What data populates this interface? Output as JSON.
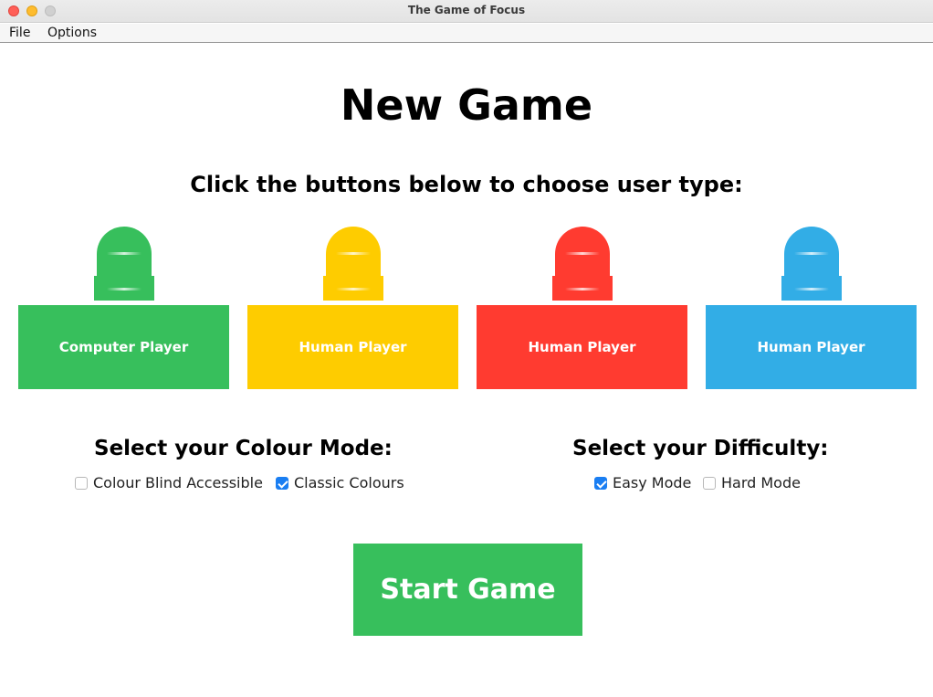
{
  "window": {
    "title": "The Game of Focus"
  },
  "menu": {
    "items": [
      "File",
      "Options"
    ]
  },
  "main": {
    "title": "New Game",
    "subtitle": "Click the buttons below to choose user type:"
  },
  "players": [
    {
      "label": "Computer Player",
      "color": "#37bf5c"
    },
    {
      "label": "Human Player",
      "color": "#fecc00"
    },
    {
      "label": "Human Player",
      "color": "#ff3b30"
    },
    {
      "label": "Human Player",
      "color": "#32ade6"
    }
  ],
  "colour_mode": {
    "heading": "Select your Colour Mode:",
    "options": [
      {
        "label": "Colour Blind Accessible",
        "checked": false
      },
      {
        "label": "Classic Colours",
        "checked": true
      }
    ]
  },
  "difficulty": {
    "heading": "Select your Difficulty:",
    "options": [
      {
        "label": "Easy Mode",
        "checked": true
      },
      {
        "label": "Hard Mode",
        "checked": false
      }
    ]
  },
  "start_button": {
    "label": "Start Game",
    "color": "#37bf5c"
  }
}
